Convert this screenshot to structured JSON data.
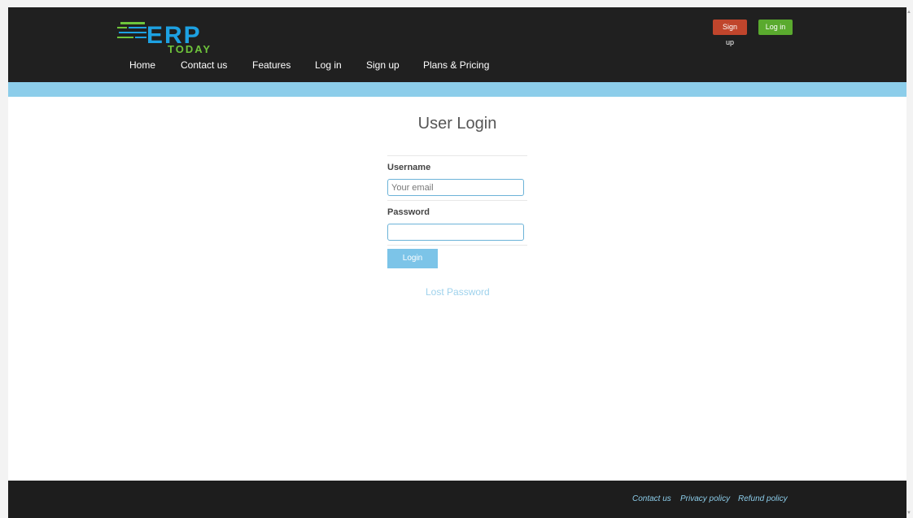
{
  "logo": {
    "top_text": "ERP",
    "bottom_text": "TODAY",
    "colors": {
      "top": "#1da1e2",
      "bottom": "#6ec43b",
      "lines": "#6ec43b"
    }
  },
  "header_buttons": {
    "signup": {
      "label": "Sign up",
      "color": "#c0452c"
    },
    "login": {
      "label": "Log in",
      "color": "#5aaa2e"
    }
  },
  "nav": {
    "items": [
      {
        "label": "Home"
      },
      {
        "label": "Contact us"
      },
      {
        "label": "Features"
      },
      {
        "label": "Log in"
      },
      {
        "label": "Sign up"
      },
      {
        "label": "Plans & Pricing"
      }
    ]
  },
  "login": {
    "title": "User Login",
    "username_label": "Username",
    "username_placeholder": "Your email",
    "password_label": "Password",
    "button_label": "Login",
    "lost_password": "Lost Password"
  },
  "footer": {
    "links": [
      {
        "label": "Contact us"
      },
      {
        "label": "Privacy policy"
      },
      {
        "label": "Refund policy"
      }
    ]
  }
}
